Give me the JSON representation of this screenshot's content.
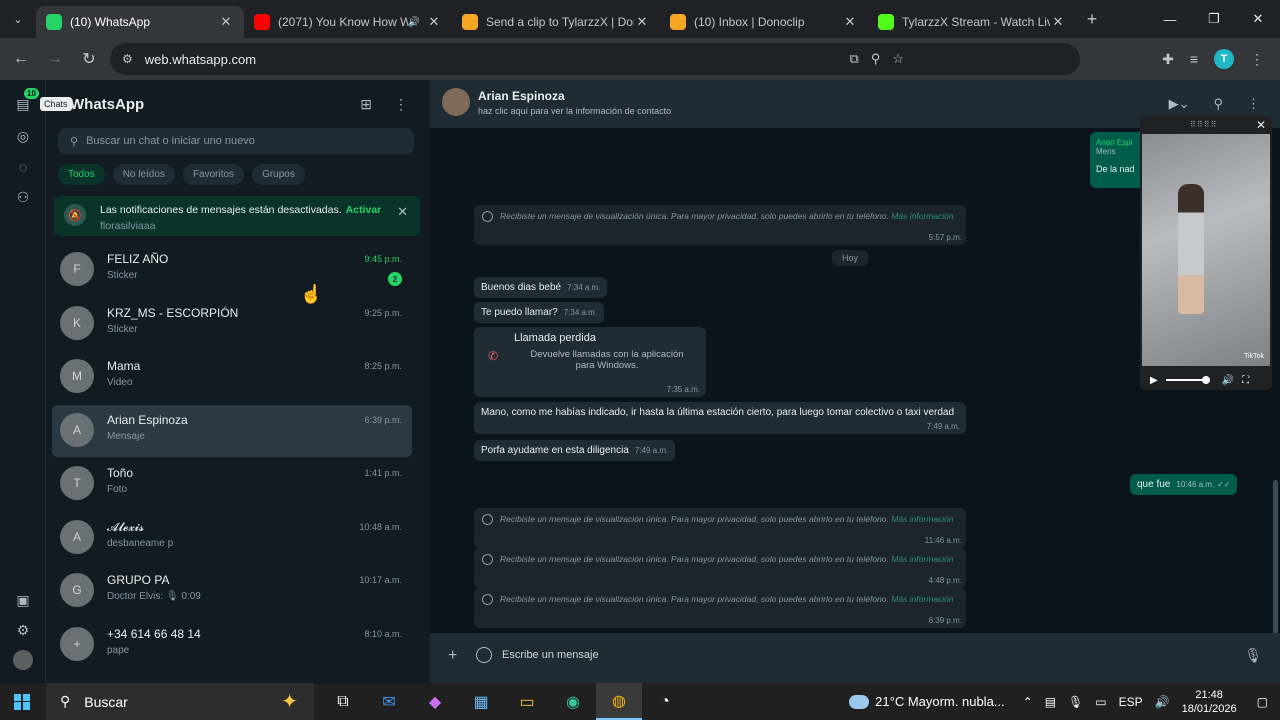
{
  "browser": {
    "tabs": [
      {
        "title": "(10) WhatsApp",
        "icon": "whatsapp-icon",
        "color": "#25d366",
        "active": true
      },
      {
        "title": "(2071) You Know How W",
        "icon": "youtube-icon",
        "color": "#ff0000",
        "active": false,
        "sound": true
      },
      {
        "title": "Send a clip to TylarzzX | Don",
        "icon": "donoclip-icon",
        "color": "#f5a623",
        "active": false
      },
      {
        "title": "(10) Inbox | Donoclip",
        "icon": "donoclip-icon",
        "color": "#f5a623",
        "active": false
      },
      {
        "title": "TylarzzX Stream - Watch Live",
        "icon": "kick-icon",
        "color": "#53fc18",
        "active": false
      }
    ],
    "url": "web.whatsapp.com",
    "profile_initial": "T"
  },
  "rail": {
    "badge": "10",
    "tooltip": "Chats"
  },
  "sidebar": {
    "title": "WhatsApp",
    "search_placeholder": "Buscar un chat o iniciar uno nuevo",
    "filters": [
      "Todos",
      "No leídos",
      "Favoritos",
      "Grupos"
    ],
    "notification": {
      "text": "Las notificaciones de mensajes están desactivadas.",
      "action": "Activar",
      "peek": "florasilviaaa"
    },
    "chats": [
      {
        "name": "FELIZ AÑO",
        "preview": "Sticker",
        "time": "9:45 p.m.",
        "unread": "2",
        "avatar": "F"
      },
      {
        "name": "KRZ_MS - ESCORPIÓN",
        "preview": "Sticker",
        "time": "9:25 p.m.",
        "avatar": "K"
      },
      {
        "name": "Mama",
        "preview": "Video",
        "time": "8:25 p.m.",
        "avatar": "M"
      },
      {
        "name": "Arian Espinoza",
        "preview": "Mensaje",
        "time": "6:39 p.m.",
        "avatar": "A",
        "selected": true
      },
      {
        "name": "Toño",
        "preview": "Foto",
        "time": "1:41 p.m.",
        "avatar": "T"
      },
      {
        "name": "𝓐𝓵𝓮𝔁𝓲𝓼",
        "preview": "desbaneame p",
        "time": "10:48 a.m.",
        "avatar": "A"
      },
      {
        "name": "GRUPO PA",
        "preview": "Doctor Elvis: 🎙 0:09",
        "time": "10:17 a.m.",
        "avatar": "G"
      },
      {
        "name": "+34 614 66 48 14",
        "preview": "pape",
        "time": "8:10 a.m.",
        "avatar": "+"
      }
    ]
  },
  "conversation": {
    "contact_name": "Arian Espinoza",
    "contact_sub": "haz clic aquí para ver la información de contacto",
    "day_label": "Hoy",
    "view_once_text": "Recibiste un mensaje de visualización única. Para mayor privacidad, solo puedes abrirlo en tu teléfono.",
    "more_info": "Más información",
    "view_once_times": [
      "5:57 p.m.",
      "11:46 a.m.",
      "4:48 p.m.",
      "6:39 p.m."
    ],
    "messages": [
      {
        "text": "Buenos dias bebé",
        "time": "7:34 a.m."
      },
      {
        "text": "Te puedo llamar?",
        "time": "7:34 a.m."
      },
      {
        "text": "Mano, como me habías indicado, ir hasta la última estación cierto, para luego tomar colectivo o taxi verdad",
        "time": "7:49 a.m."
      },
      {
        "text": "Porfa ayudame en esta diligencia",
        "time": "7:49 a.m."
      },
      {
        "text": "que fue",
        "time": "10:46 a.m."
      }
    ],
    "missed_call": {
      "title": "Llamada perdida",
      "desc": "Devuelve llamadas con la aplicación para Windows.",
      "time": "7:35 a.m."
    },
    "peek_out": {
      "name": "Arian Espi",
      "sub": "Mens",
      "text": "De la nad"
    },
    "composer_placeholder": "Escribe un mensaje"
  },
  "pip": {
    "overlay_text": "TikTok"
  },
  "taskbar": {
    "search": "Buscar",
    "weather": "21°C  Mayorm. nubla...",
    "lang": "ESP",
    "time": "21:48",
    "date": "18/01/2026"
  }
}
